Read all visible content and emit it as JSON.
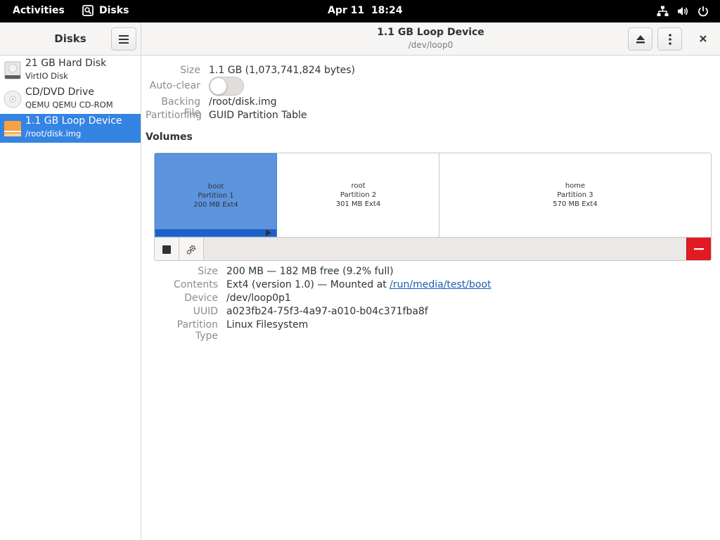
{
  "topbar": {
    "activities": "Activities",
    "app_name": "Disks",
    "clock": "Apr 11  18:24",
    "icons": [
      "network-icon",
      "volume-icon",
      "power-icon"
    ]
  },
  "sidebar": {
    "title": "Disks",
    "items": [
      {
        "name": "21 GB Hard Disk",
        "sub": "VirtIO Disk",
        "icon": "hard-disk-icon"
      },
      {
        "name": "CD/DVD Drive",
        "sub": "QEMU QEMU CD-ROM",
        "icon": "optical-drive-icon"
      },
      {
        "name": "1.1 GB Loop Device",
        "sub": "/root/disk.img",
        "icon": "loop-device-icon",
        "selected": true
      }
    ]
  },
  "header": {
    "title": "1.1 GB Loop Device",
    "subtitle": "/dev/loop0"
  },
  "device_info": {
    "size_label": "Size",
    "size_value": "1.1 GB (1,073,741,824 bytes)",
    "autoclear_label": "Auto-clear",
    "autoclear_on": false,
    "backing_label": "Backing File",
    "backing_value": "/root/disk.img",
    "partitioning_label": "Partitioning",
    "partitioning_value": "GUID Partition Table"
  },
  "volumes": {
    "heading": "Volumes",
    "partitions": [
      {
        "name": "boot",
        "number": "Partition 1",
        "details": "200 MB Ext4",
        "selected": true
      },
      {
        "name": "root",
        "number": "Partition 2",
        "details": "301 MB Ext4"
      },
      {
        "name": "home",
        "number": "Partition 3",
        "details": "570 MB Ext4"
      }
    ]
  },
  "partition_info": {
    "size_label": "Size",
    "size_value": "200 MB — 182 MB free (9.2% full)",
    "contents_label": "Contents",
    "contents_prefix": "Ext4 (version 1.0) — Mounted at ",
    "contents_link": "/run/media/test/boot",
    "device_label": "Device",
    "device_value": "/dev/loop0p1",
    "uuid_label": "UUID",
    "uuid_value": "a023fb24-75f3-4a97-a010-b04c371fba8f",
    "ptype_label": "Partition Type",
    "ptype_value": "Linux Filesystem"
  },
  "colors": {
    "accent": "#3584e4",
    "selected_partition": "#5d94de",
    "destructive": "#e01b24",
    "loop_icon": "#f6a245"
  }
}
